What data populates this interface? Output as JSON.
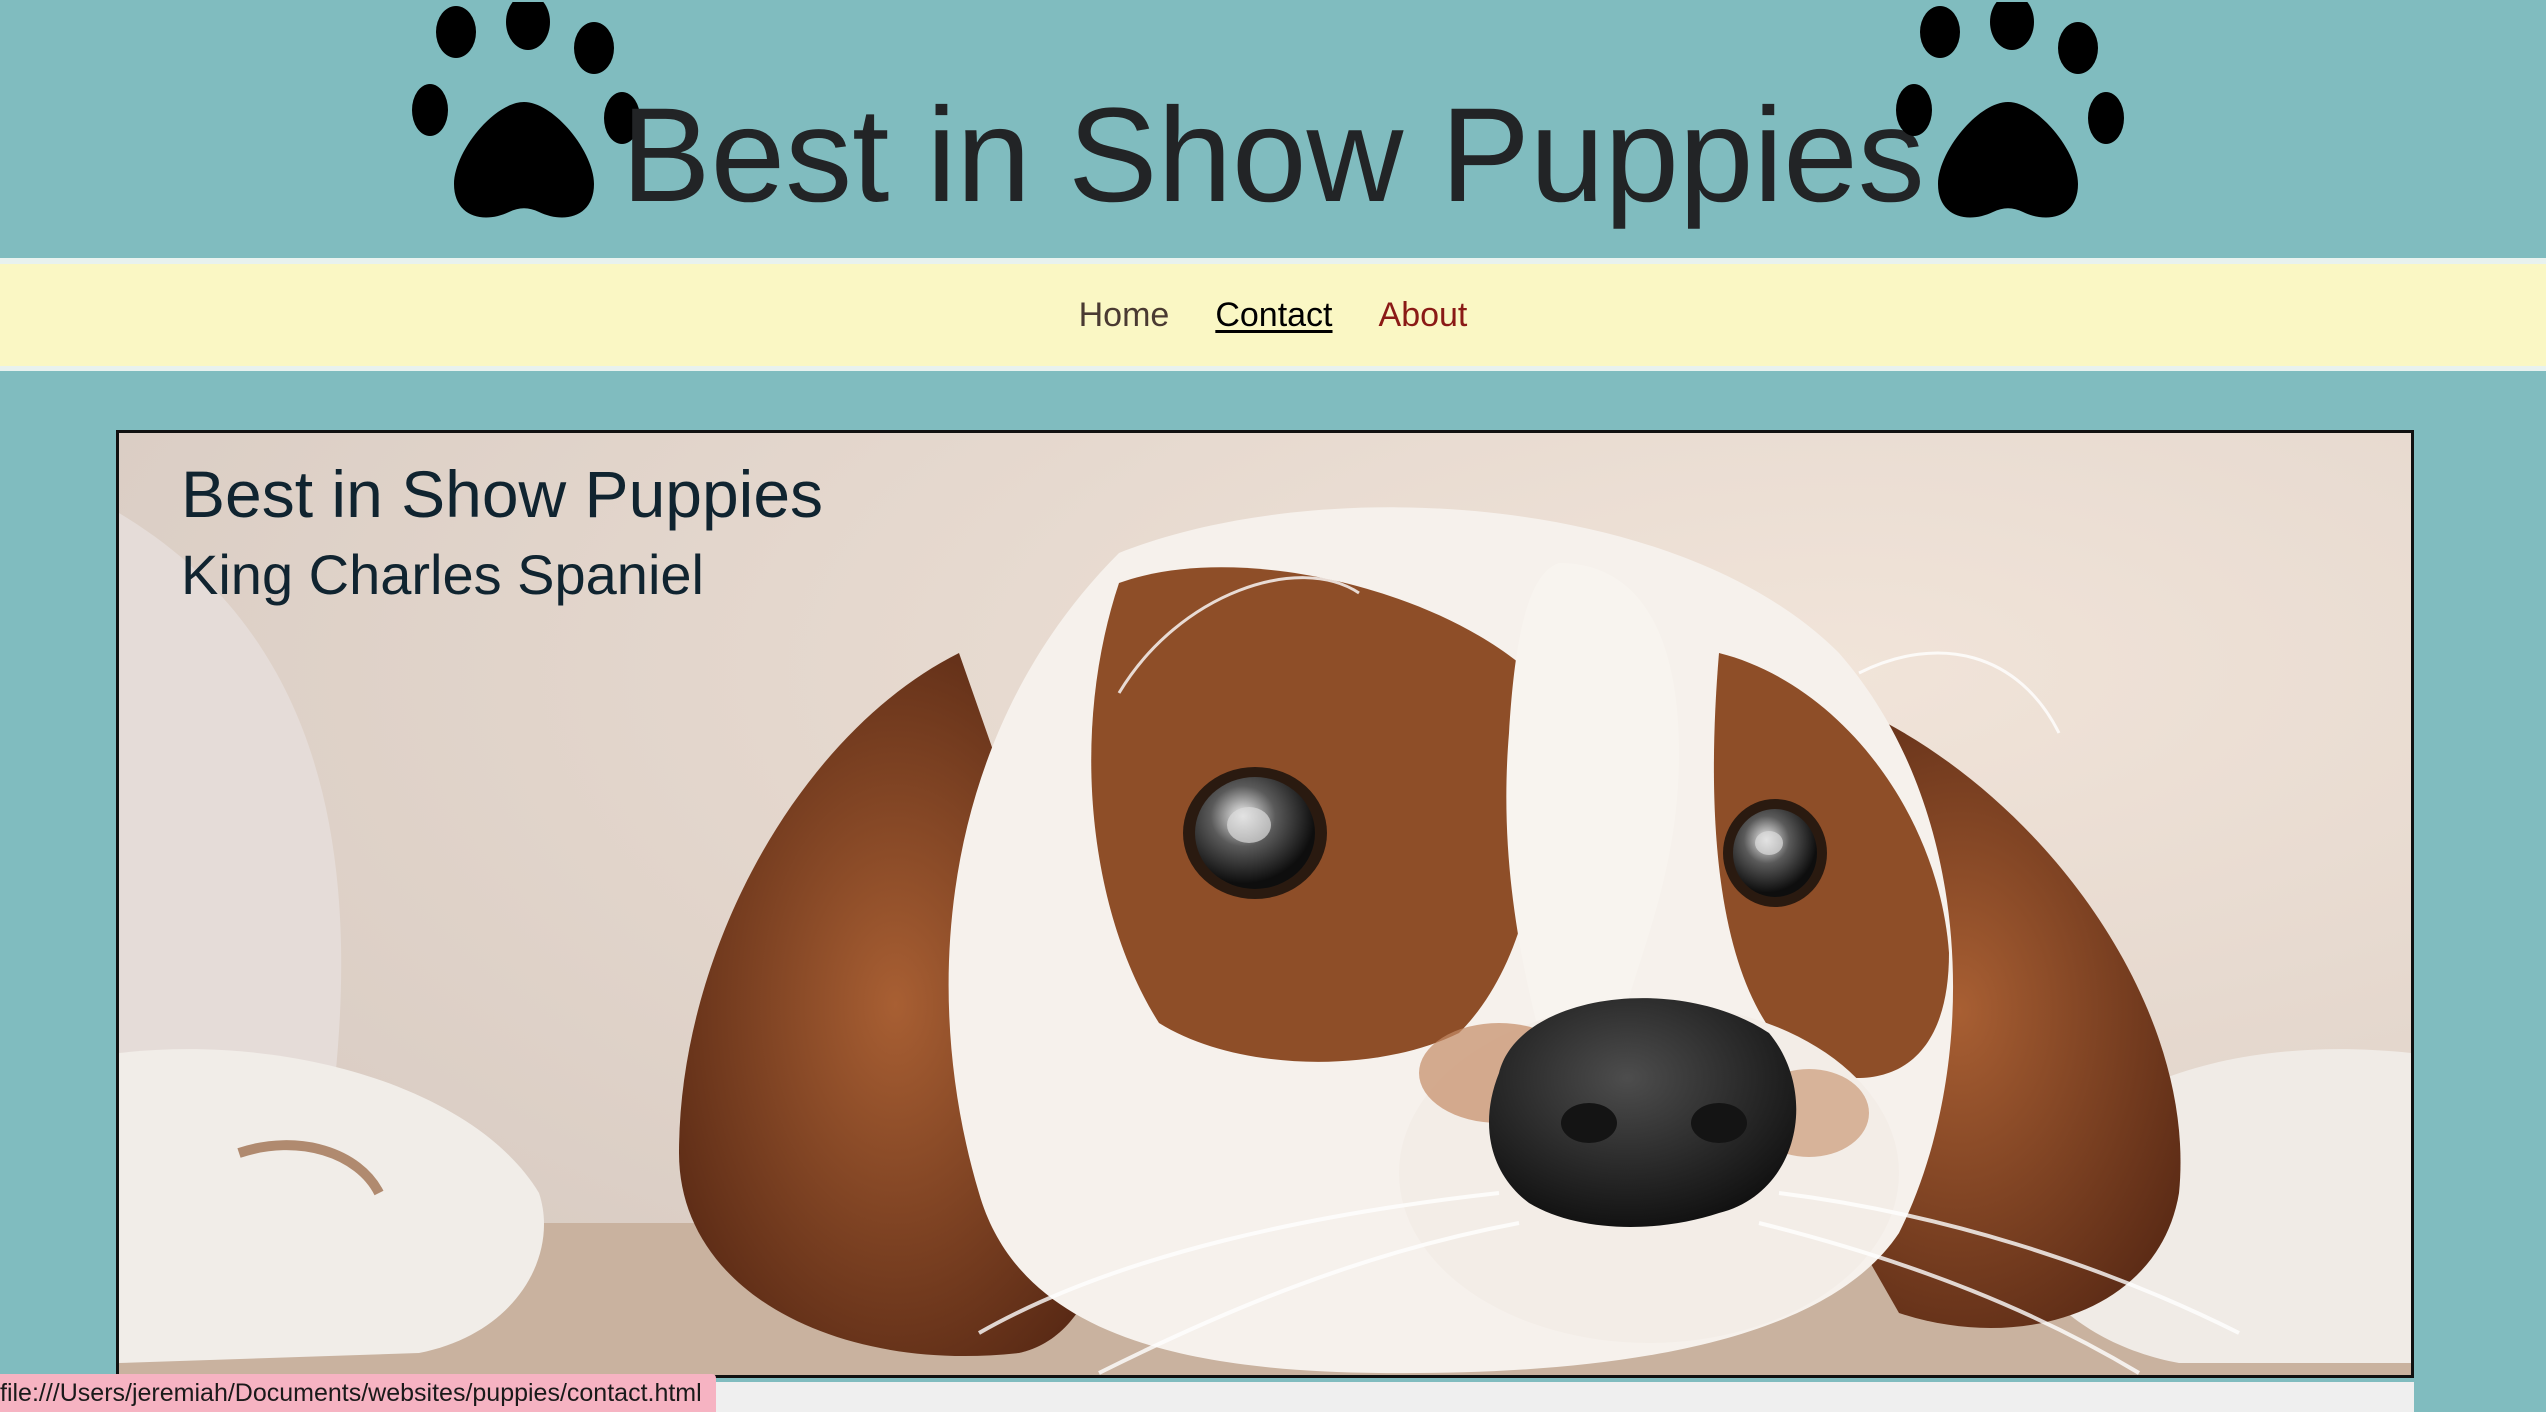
{
  "header": {
    "title": "Best in Show Puppies",
    "left_icon": "paw-print-icon",
    "right_icon": "paw-print-icon"
  },
  "nav": {
    "items": [
      {
        "label": "Home",
        "state": "default"
      },
      {
        "label": "Contact",
        "state": "hover"
      },
      {
        "label": "About",
        "state": "visited"
      }
    ]
  },
  "hero": {
    "title": "Best in Show Puppies",
    "subtitle": "King Charles Spaniel",
    "image": "king-charles-spaniel-photo"
  },
  "status_bar": {
    "url": "file:///Users/jeremiah/Documents/websites/puppies/contact.html"
  },
  "colors": {
    "page_background": "#80bcbf",
    "nav_background": "#faf7c4",
    "nav_home": "#4a3a32",
    "nav_contact": "#000000",
    "nav_about": "#8a1a16",
    "hero_text": "#102430",
    "status_bar": "#f6b3c2"
  }
}
